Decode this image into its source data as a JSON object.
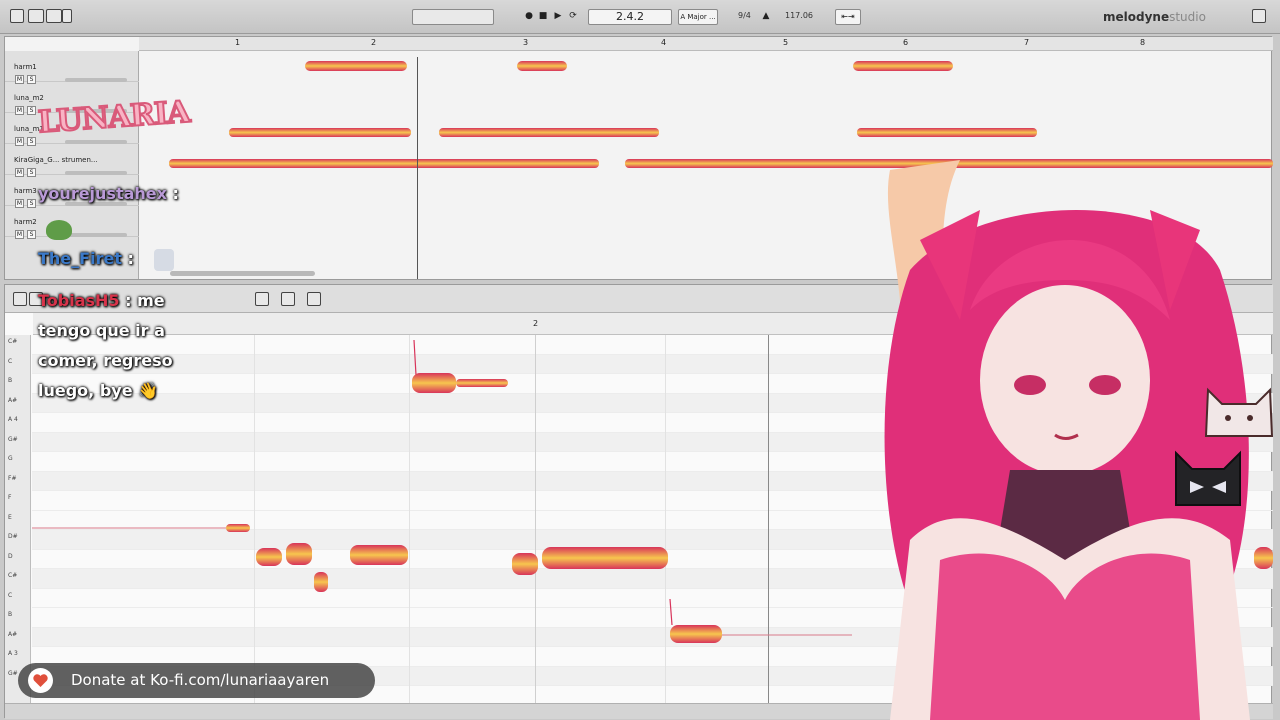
{
  "app": {
    "brand": "melodyne",
    "brand_suffix": "studio",
    "position_display": "2.4.2",
    "key_display": "A Major ...",
    "time_signature": "9/4",
    "tempo": "117.06"
  },
  "arrangement": {
    "ruler_bars": [
      "1",
      "2",
      "3",
      "4",
      "5",
      "6",
      "7",
      "8"
    ],
    "tracks": [
      {
        "name": "harm1"
      },
      {
        "name": "luna_m2"
      },
      {
        "name": "luna_m1"
      },
      {
        "name": "KiraGiga_G... strumen..."
      },
      {
        "name": "harm3"
      },
      {
        "name": "harm2"
      }
    ],
    "mute_label": "M",
    "solo_label": "S"
  },
  "editor": {
    "ruler_bars": [
      "2"
    ],
    "pitch_labels": [
      "C#",
      "C",
      "B",
      "A#",
      "A 4",
      "G#",
      "G",
      "F#",
      "F",
      "E",
      "D#",
      "D",
      "C#",
      "C",
      "B",
      "A#",
      "A 3",
      "G#"
    ]
  },
  "chat": [
    {
      "user": "yourejustahex",
      "color": "#b99ad6",
      "sep": ":",
      "message": ""
    },
    {
      "user": "The_Firet",
      "color": "#3b79c8",
      "sep": ":",
      "message": ""
    },
    {
      "user": "TobiasH5",
      "color": "#d8344b",
      "sep": ":",
      "message": "me tengo que ir a comer, regreso luego, bye 👋"
    }
  ],
  "overlay": {
    "logo_text": "LUNARIA",
    "donate_text": "Donate at Ko-fi.com/lunariaayaren"
  },
  "colors": {
    "blob_fill": "#f5b84a",
    "blob_edge": "#d8345a",
    "hair": "#e8357a",
    "skin": "#f7e3e1"
  },
  "icons": {
    "kofi": "heart-cup-icon",
    "metronome": "metronome-icon",
    "play": "play-icon",
    "stop": "stop-icon"
  }
}
